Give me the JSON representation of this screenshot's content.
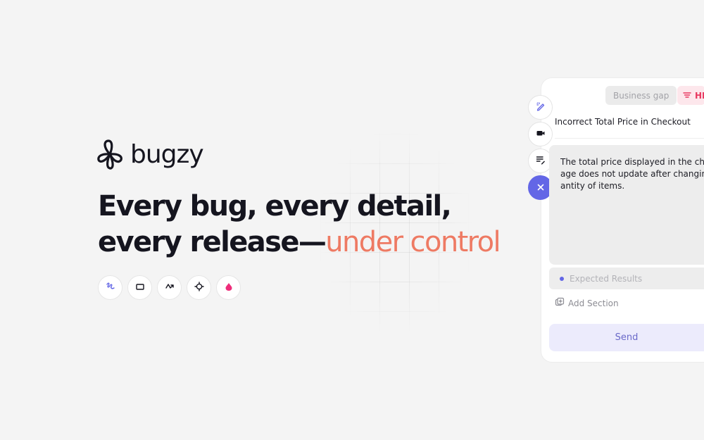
{
  "brand": {
    "name": "bugzy",
    "logo_icon": "bugzy-knot-logo"
  },
  "headline": {
    "line1": "Every bug, every detail,",
    "line2_prefix": "every release—",
    "line2_accent": "under control",
    "accent_color": "#ee7a63"
  },
  "toolbar": {
    "tools": [
      {
        "name": "draw-tool",
        "icon": "scribble-icon"
      },
      {
        "name": "rectangle-tool",
        "icon": "rectangle-icon"
      },
      {
        "name": "line-tool",
        "icon": "zigzag-arrow-icon"
      },
      {
        "name": "crop-tool",
        "icon": "crosshair-icon"
      },
      {
        "name": "color-tool",
        "icon": "drop-icon",
        "color": "#ee2d7a"
      }
    ]
  },
  "panel": {
    "side_buttons": [
      {
        "name": "edit-button",
        "icon": "pencil-sparkle-icon"
      },
      {
        "name": "video-button",
        "icon": "video-camera-icon"
      },
      {
        "name": "notes-button",
        "icon": "list-edit-icon"
      },
      {
        "name": "close-button",
        "icon": "close-icon"
      }
    ],
    "chips": {
      "category": "Business gap",
      "priority": "HIGH",
      "priority_color": "#e8375f"
    },
    "title": "Incorrect Total Price in Checkout",
    "description_lines": [
      "The total price displayed in the checkout p",
      "age does not update after changing the qu",
      "antity of items."
    ],
    "expected_results_label": "Expected Results",
    "add_section_label": "Add Section",
    "send_label": "Send",
    "accent_color": "#6366e6"
  }
}
